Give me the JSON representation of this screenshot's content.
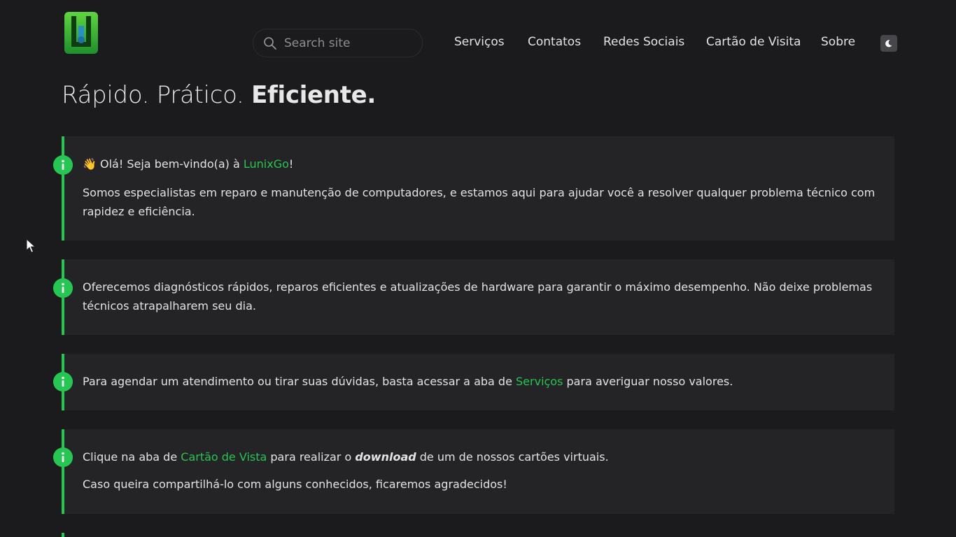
{
  "header": {
    "logo_name": "LunixGo logo",
    "search": {
      "placeholder": "Search site",
      "value": ""
    },
    "nav": [
      {
        "label": "Serviços"
      },
      {
        "label": "Contatos"
      },
      {
        "label": "Redes Sociais"
      },
      {
        "label": "Cartão de Visita"
      },
      {
        "label": "Sobre"
      }
    ],
    "theme_toggle_icon": "moon-icon"
  },
  "headline": {
    "part1": "Rápido. Prático. ",
    "part2": "Eficiente."
  },
  "admonitions": [
    {
      "icon": "info-icon",
      "line1_prefix": "👋 Olá! Seja bem-vindo(a) à ",
      "line1_link": "LunixGo",
      "line1_suffix": "!",
      "line2": "Somos especialistas em reparo e manutenção de computadores, e estamos aqui para ajudar você a resolver qualquer problema técnico com rapidez e eficiência."
    },
    {
      "icon": "info-icon",
      "text": "Oferecemos diagnósticos rápidos, reparos eficientes e atualizações de hardware para garantir o máximo desempenho. Não deixe problemas técnicos atrapalharem seu dia."
    },
    {
      "icon": "info-icon",
      "prefix": "Para agendar um atendimento ou tirar suas dúvidas, basta acessar a aba de ",
      "link": "Serviços",
      "suffix": " para averiguar nosso valores."
    },
    {
      "icon": "info-icon",
      "prefix": "Clique na aba de ",
      "link": "Cartão de Vista",
      "middle": " para realizar o ",
      "emphasis": "download",
      "suffix": " de um de nossos cartões virtuais.",
      "line2": "Caso queira compartilhá-lo com alguns conhecidos, ficaremos agradecidos!"
    }
  ],
  "colors": {
    "background": "#1b1b1d",
    "surface": "#242426",
    "accent": "#25c651",
    "text": "#e3e3e3"
  }
}
